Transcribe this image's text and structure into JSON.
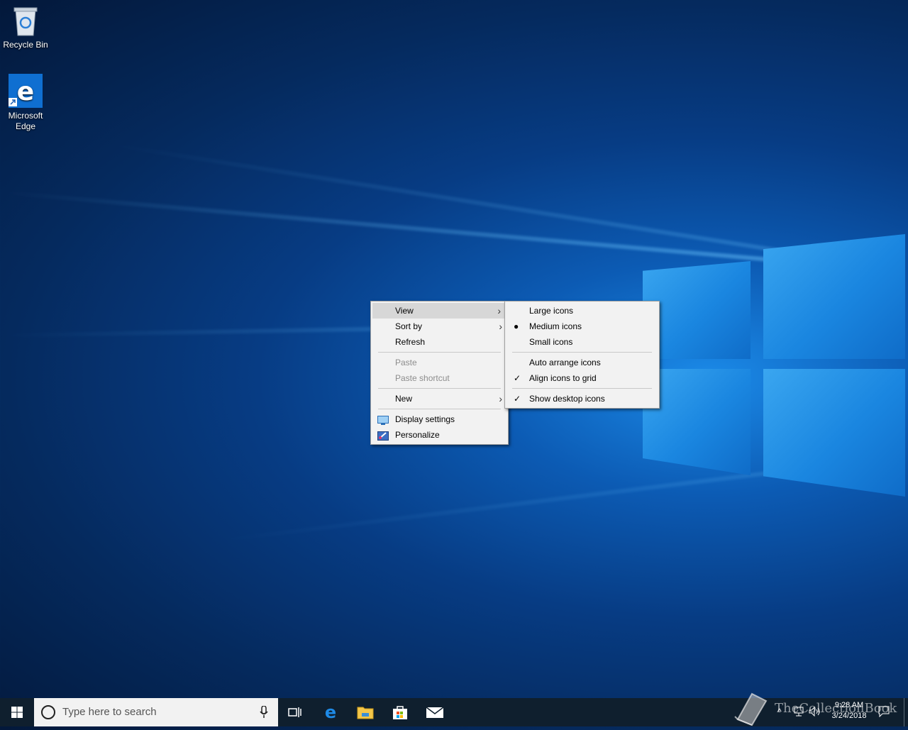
{
  "desktop": {
    "icons": [
      {
        "label": "Recycle Bin",
        "icon": "recycle-bin-icon"
      },
      {
        "label": "Microsoft Edge",
        "icon": "edge-icon"
      }
    ]
  },
  "context_menu": {
    "items": [
      {
        "label": "View"
      },
      {
        "label": "Sort by"
      },
      {
        "label": "Refresh"
      },
      {
        "label": "Paste"
      },
      {
        "label": "Paste shortcut"
      },
      {
        "label": "New"
      },
      {
        "label": "Display settings"
      },
      {
        "label": "Personalize"
      }
    ]
  },
  "view_submenu": {
    "items": [
      {
        "label": "Large icons"
      },
      {
        "label": "Medium icons"
      },
      {
        "label": "Small icons"
      },
      {
        "label": "Auto arrange icons"
      },
      {
        "label": "Align icons to grid"
      },
      {
        "label": "Show desktop icons"
      }
    ]
  },
  "taskbar": {
    "search_placeholder": "Type here to search",
    "time": "9:28 AM",
    "date": "3/24/2018",
    "watermark": "TheCollectionBook"
  },
  "colors": {
    "taskbar": "#0f1f2e",
    "accent": "#0078d7",
    "menu_bg": "#f2f2f2"
  }
}
